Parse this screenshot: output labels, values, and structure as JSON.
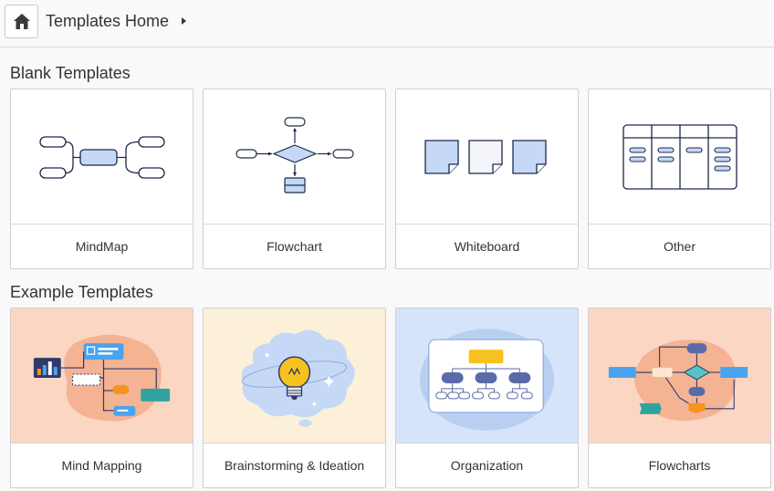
{
  "header": {
    "breadcrumb": "Templates Home",
    "home_icon": "home-icon",
    "caret_icon": "caret-right-icon"
  },
  "blank_section": {
    "title": "Blank Templates",
    "cards": [
      {
        "label": "MindMap",
        "icon": "mindmap-icon"
      },
      {
        "label": "Flowchart",
        "icon": "flowchart-icon"
      },
      {
        "label": "Whiteboard",
        "icon": "whiteboard-icon"
      },
      {
        "label": "Other",
        "icon": "table-board-icon"
      }
    ]
  },
  "example_section": {
    "title": "Example Templates",
    "cards": [
      {
        "label": "Mind Mapping",
        "icon": "mind-mapping-illustration",
        "bg": "#fbd6c2"
      },
      {
        "label": "Brainstorming & Ideation",
        "icon": "lightbulb-illustration",
        "bg": "#fdf0d9"
      },
      {
        "label": "Organization",
        "icon": "org-chart-illustration",
        "bg": "#d6e4f9"
      },
      {
        "label": "Flowcharts",
        "icon": "flowcharts-illustration",
        "bg": "#fbd6c2"
      }
    ]
  },
  "colors": {
    "accent_blue": "#c5d9f7",
    "stroke": "#1e2a4a",
    "orange": "#f7931e",
    "teal": "#2fa3a0"
  }
}
